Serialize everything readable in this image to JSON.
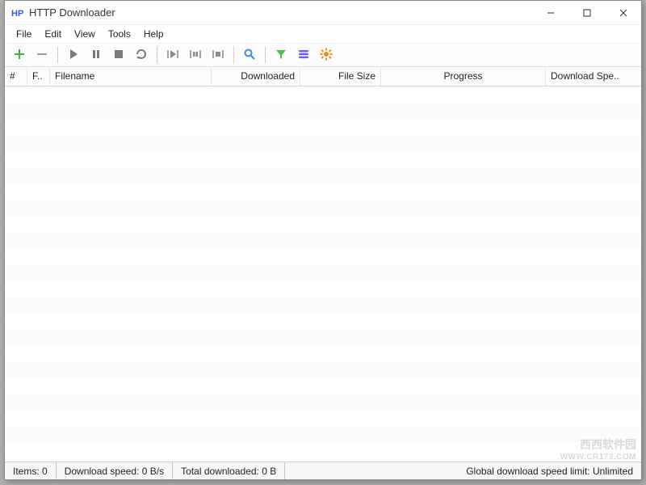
{
  "window": {
    "title": "HTTP Downloader"
  },
  "menubar": {
    "file": "File",
    "edit": "Edit",
    "view": "View",
    "tools": "Tools",
    "help": "Help"
  },
  "toolbar_icons": {
    "add": "add-icon",
    "remove": "remove-icon",
    "start": "play-icon",
    "pause": "pause-icon",
    "stop": "stop-icon",
    "restart": "restart-icon",
    "pause_active": "pause-active-icon",
    "stop_active": "stop-active-icon",
    "remove_completed": "remove-completed-icon",
    "search": "search-icon",
    "filter": "filter-icon",
    "queue": "queue-icon",
    "options": "options-icon"
  },
  "columns": {
    "num": "#",
    "ftype": "F..",
    "filename": "Filename",
    "downloaded": "Downloaded",
    "file_size": "File Size",
    "progress": "Progress",
    "download_speed": "Download Spe.."
  },
  "rows": [],
  "statusbar": {
    "items_label": "Items:",
    "items_value": "0",
    "dl_speed_label": "Download speed:",
    "dl_speed_value": "0 B/s",
    "total_dl_label": "Total downloaded:",
    "total_dl_value": "0 B",
    "global_limit_label": "Global download speed limit: Unlimited"
  },
  "watermark": {
    "line1": "西西软件园",
    "line2": "WWW.CR173.COM"
  },
  "colors": {
    "add": "#3db33d",
    "remove": "#9b9b9b",
    "playback": "#7a7a7a",
    "bracket": "#8a8a8a",
    "search": "#3a8be8",
    "filter": "#47c24a",
    "queue": "#6a62e8",
    "options": "#f08c1a"
  }
}
